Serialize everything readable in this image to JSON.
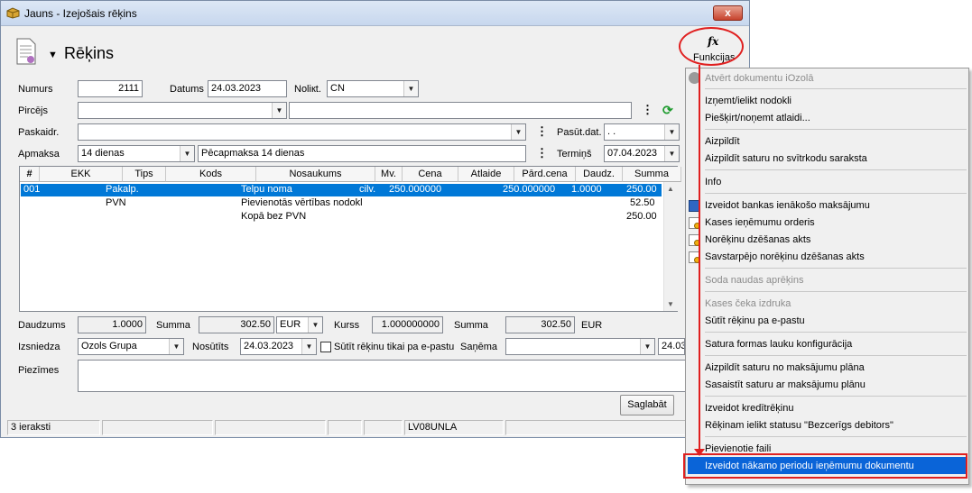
{
  "window": {
    "title": "Jauns - Izejošais rēķins",
    "close_label": "x",
    "doc_title": "Rēķins",
    "functions_label": "Funkcijas",
    "functions_icon": "fx"
  },
  "form": {
    "numurs_label": "Numurs",
    "numurs": "2111",
    "datums_label": "Datums",
    "datums": "24.03.2023",
    "noliktava_label": "Noliкt.",
    "noliktava": "CN",
    "pircejs_label": "Pircējs",
    "pircejs": "",
    "paskaidr_label": "Paskaidr.",
    "paskaidr": "",
    "pasut_label": "Pasūt.dat.",
    "pasut_dat": ". .",
    "apmaksa_label": "Apmaksa",
    "apmaksa": "14 dienas",
    "apmaksa_desc": "Pēcapmaksa 14 dienas",
    "termins_label": "Termiņš",
    "termins": "07.04.2023"
  },
  "grid": {
    "columns": [
      "#",
      "EKK",
      "Tips",
      "Kods",
      "Nosaukums",
      "Mv.",
      "Cena",
      "Atlaide",
      "Pārd.cena",
      "Daudz.",
      "Summa"
    ],
    "rows": [
      {
        "num": "001",
        "tips": "Pakalp.",
        "nosaukums": "Telpu noma",
        "mv": "cilv.",
        "cena": "250.000000",
        "pard_cena": "250.000000",
        "daudz": "1.0000",
        "summa": "250.00"
      },
      {
        "num": "",
        "tips": "PVN",
        "nosaukums": "Pievienotās vērtības nodokl",
        "mv": "",
        "cena": "",
        "pard_cena": "",
        "daudz": "",
        "summa": "52.50"
      },
      {
        "num": "",
        "tips": "",
        "nosaukums": "Kopā bez PVN",
        "mv": "",
        "cena": "",
        "pard_cena": "",
        "daudz": "",
        "summa": "250.00"
      }
    ]
  },
  "totals": {
    "daudzums_label": "Daudzums",
    "daudzums": "1.0000",
    "summa_label": "Summa",
    "summa": "302.50",
    "valuta": "EUR",
    "kurss_label": "Kurss",
    "kurss": "1.000000000",
    "summa2_label": "Summa",
    "summa2": "302.50",
    "valuta2": "EUR"
  },
  "issue": {
    "izsniedza_label": "Izsniedza",
    "izsniedza": "Ozols Grupa",
    "nosutits_label": "Nosūtīts",
    "nosutits": "24.03.2023",
    "email_only_label": "Sūtīt rēķinu tikai pa e-pastu",
    "sanema_label": "Saņēma",
    "sanema": "",
    "sanema_date": "24.03"
  },
  "notes": {
    "label": "Piezīmes",
    "value": ""
  },
  "save_label": "Saglabāt",
  "status": {
    "records": "3 ieraksti",
    "code": "LV08UNLA"
  },
  "menu": {
    "items": [
      {
        "label": "Atvērt dokumentu iOzolā",
        "disabled": true
      },
      {
        "label": "Izņemt/ielikt nodokli",
        "disabled": false
      },
      {
        "label": "Piešķirt/noņemt atlaidi...",
        "disabled": false
      },
      {
        "label": "Aizpildīt",
        "disabled": false
      },
      {
        "label": "Aizpildīt saturu no svītrkodu saraksta",
        "disabled": false
      },
      {
        "label": "Info",
        "disabled": false
      },
      {
        "label": "Izveidot bankas ienākošo maksājumu",
        "disabled": false
      },
      {
        "label": "Kases ieņēmumu orderis",
        "disabled": false
      },
      {
        "label": "Norēķinu dzēšanas akts",
        "disabled": false
      },
      {
        "label": "Savstarpējo norēķinu dzēšanas akts",
        "disabled": false
      },
      {
        "label": "Soda naudas aprēķins",
        "disabled": true
      },
      {
        "label": "Kases čeka izdruka",
        "disabled": true
      },
      {
        "label": "Sūtīt rēķinu pa e-pastu",
        "disabled": false
      },
      {
        "label": "Satura formas lauku konfigurācija",
        "disabled": false
      },
      {
        "label": "Aizpildīt saturu no maksājumu plāna",
        "disabled": false
      },
      {
        "label": "Sasaistīt saturu ar maksājumu plānu",
        "disabled": false
      },
      {
        "label": "Izveidot kredītrēķinu",
        "disabled": false
      },
      {
        "label": "Rēķinam ielikt statusu \"Bezcerīgs debitors\"",
        "disabled": false
      },
      {
        "label": "Pievienotie faili",
        "disabled": false
      },
      {
        "label": "Izveidot nākamo periodu ieņēmumu dokumentu",
        "disabled": false,
        "highlighted": true
      }
    ]
  },
  "colors": {
    "highlight": "#0a64d8",
    "annotation_red": "#e02020",
    "selection": "#0078d7"
  }
}
